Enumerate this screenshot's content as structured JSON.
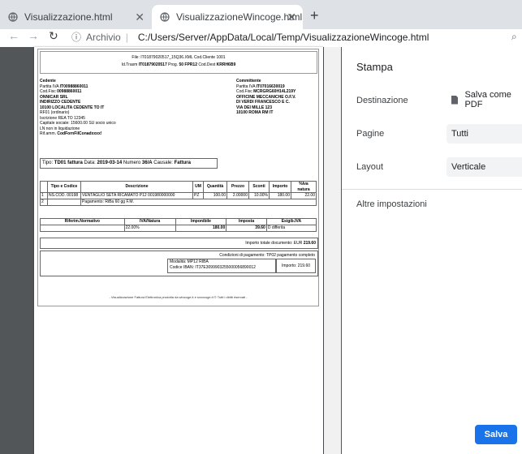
{
  "browser": {
    "tabs": [
      {
        "label": "Visualizzazione.html",
        "active": false
      },
      {
        "label": "VisualizzazioneWincoge.html",
        "active": true
      }
    ],
    "address": {
      "scheme_label": "Archivio",
      "url": "C:/Users/Server/AppData/Local/Temp/VisualizzazioneWincoge.html"
    }
  },
  "invoice": {
    "header_line1": "File: IT01879020517_15Q36.XML   Cod.Cliente 1001",
    "header_line2_prefix": "Id.Trasm ",
    "header_line2_id": "IT01879020517",
    "header_line2_mid": " Prog. ",
    "header_line2_prog": "50 FPR12",
    "header_line2_dest_label": " Cod.Dest ",
    "header_line2_dest": "KRRH6B9",
    "cedente": {
      "title": "Cedente",
      "piva_label": "Partita IVA ",
      "piva": "IT00988860011",
      "cf_label": "Cod.Fisc ",
      "cf": "00988860011",
      "name": "ONNICAR SRL",
      "address": "INDIRIZZO CEDENTE",
      "city": "10100 LOCALITA CEDENTE TO IT",
      "regime": "RF01 (ordinario)",
      "rea": "Iscrizione REA TO 12345",
      "capitale": "Capitale sociale: 15600.00 SU socio unico",
      "liquidazione": "LN non in liquidazione",
      "rif_label": "Rif.amm. ",
      "rif": "CodFornFilConadxxxx!"
    },
    "committente": {
      "title": "Committente",
      "piva_label": "Partita IVA ",
      "piva": "IT07016630019",
      "cf_label": "Cod.Fisc ",
      "cf": "MCRGRG60H14L219Y",
      "name": "OFFICINE MECCANICHE O.F.V.",
      "name2": "DI VERDI FRANCESCO E C.",
      "address": "VIA DEI MILLE 123",
      "city": "10100 ROMA RM IT"
    },
    "tipo": {
      "label": "Tipo: ",
      "value": "TD01 fattura",
      "data_label": " Data: ",
      "data": "2019-03-14",
      "numero_label": " Numero ",
      "numero": "36/A",
      "causale_label": " Causale: ",
      "causale": "Fattura"
    },
    "lines_headers": [
      "",
      "Tipo e Codice",
      "Descrizione",
      "UM",
      "Quantità",
      "Prezzo",
      "Sconti",
      "Importo",
      "%Iva natura"
    ],
    "lines": [
      [
        "1",
        "NS.COD. 00198",
        "VENTAGLIO SETA RICAMATO P12 001980000000",
        "PZ",
        "100.00",
        "2.00000",
        "10.00%",
        "180.00",
        "22.00"
      ],
      [
        "2",
        "",
        "Pagamento: RiBa 60 gg F.M.",
        "",
        "",
        "",
        "",
        "",
        ""
      ]
    ],
    "summary_headers": [
      "Riferim.Normativo",
      "IVA/Natura",
      "Imponibile",
      "Imposta",
      "Esigib.IVA"
    ],
    "summary_row": [
      "",
      "22.00%",
      "180.00",
      "39.60",
      "D differita"
    ],
    "total_label": "Importo totale documento: EUR ",
    "total_value": "219.60",
    "payment_conditions": "Condizioni di pagamento: TP02 pagamento completo",
    "payment_mode": "Modalità: MP12 RIBA",
    "payment_iban": "Codice IBAN: IT37E3099903255000056890012",
    "payment_amount": "Importo: 219.60",
    "footer": "- Visualizzazione Fattura Elettronica prodotta da wincoge.it e sxxxcoge.it © Tutti i diritti riservati -"
  },
  "print_panel": {
    "title": "Stampa",
    "destination_label": "Destinazione",
    "destination_value": "Salva come PDF",
    "pages_label": "Pagine",
    "pages_value": "Tutti",
    "layout_label": "Layout",
    "layout_value": "Verticale",
    "more_settings": "Altre impostazioni",
    "save_button": "Salva"
  },
  "colors": {
    "accent": "#1a73e8",
    "preview_bg": "#525659",
    "tabstrip": "#dee1e6"
  }
}
